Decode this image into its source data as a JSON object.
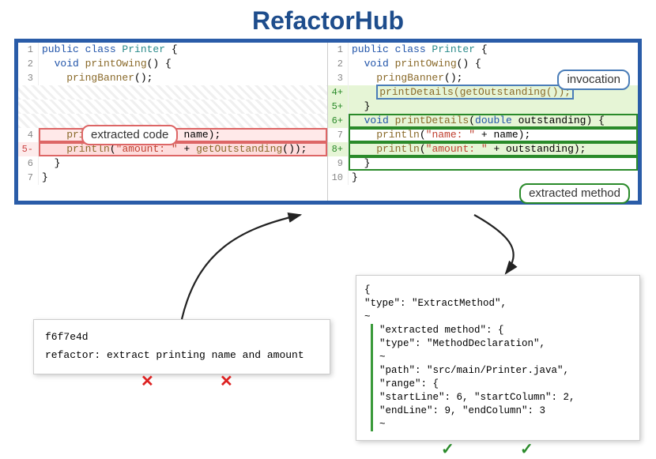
{
  "title": "RefactorHub",
  "tags": {
    "extracted_code": "extracted code",
    "invocation": "invocation",
    "extracted_method": "extracted method"
  },
  "left": {
    "lines": [
      {
        "n": "1",
        "seg": [
          {
            "t": "public ",
            "c": "tk-k"
          },
          {
            "t": "class ",
            "c": "tk-k"
          },
          {
            "t": "Printer",
            "c": "tk-t"
          },
          {
            "t": " {",
            "c": ""
          }
        ]
      },
      {
        "n": "2",
        "seg": [
          {
            "t": "  void ",
            "c": "tk-k"
          },
          {
            "t": "printOwing",
            "c": "tk-m"
          },
          {
            "t": "() {",
            "c": ""
          }
        ]
      },
      {
        "n": "3",
        "seg": [
          {
            "t": "    pringBanner",
            "c": "tk-m"
          },
          {
            "t": "();",
            "c": ""
          }
        ]
      },
      {
        "n": "",
        "seg": [],
        "hatch": true
      },
      {
        "n": "",
        "seg": [],
        "hatch": true
      },
      {
        "n": "",
        "seg": [],
        "hatch": true
      },
      {
        "n": "4",
        "seg": [
          {
            "t": "    println",
            "c": "tk-m"
          },
          {
            "t": "(",
            "c": ""
          },
          {
            "t": "\"name: \"",
            "c": "tk-s"
          },
          {
            "t": " + name);",
            "c": ""
          }
        ],
        "pink": true
      },
      {
        "n": "5-",
        "seg": [
          {
            "t": "    println",
            "c": "tk-m"
          },
          {
            "t": "(",
            "c": ""
          },
          {
            "t": "\"amount: \"",
            "c": "tk-s"
          },
          {
            "t": " + ",
            "c": ""
          },
          {
            "t": "getOutstanding",
            "c": "tk-m"
          },
          {
            "t": "());",
            "c": ""
          }
        ],
        "pink": true,
        "del": true
      },
      {
        "n": "6",
        "seg": [
          {
            "t": "  }",
            "c": ""
          }
        ]
      },
      {
        "n": "7",
        "seg": [
          {
            "t": "}",
            "c": ""
          }
        ]
      }
    ]
  },
  "right": {
    "lines": [
      {
        "n": "1",
        "seg": [
          {
            "t": "public ",
            "c": "tk-k"
          },
          {
            "t": "class ",
            "c": "tk-k"
          },
          {
            "t": "Printer",
            "c": "tk-t"
          },
          {
            "t": " {",
            "c": ""
          }
        ]
      },
      {
        "n": "2",
        "seg": [
          {
            "t": "  void ",
            "c": "tk-k"
          },
          {
            "t": "printOwing",
            "c": "tk-m"
          },
          {
            "t": "() {",
            "c": ""
          }
        ]
      },
      {
        "n": "3",
        "seg": [
          {
            "t": "    pringBanner",
            "c": "tk-m"
          },
          {
            "t": "();",
            "c": ""
          }
        ]
      },
      {
        "n": "4+",
        "seg": [
          {
            "t": "    ",
            "c": ""
          },
          {
            "t": "printDetails(getOutstanding());",
            "c": "tk-m",
            "inv": true
          }
        ],
        "add": true
      },
      {
        "n": "5+",
        "seg": [
          {
            "t": "  }",
            "c": ""
          }
        ],
        "add": true
      },
      {
        "n": "6+",
        "seg": [
          {
            "t": "  void ",
            "c": "tk-k"
          },
          {
            "t": "printDetails",
            "c": "tk-m"
          },
          {
            "t": "(",
            "c": ""
          },
          {
            "t": "double",
            "c": "tk-k"
          },
          {
            "t": " outstanding) {",
            "c": ""
          }
        ],
        "add": true,
        "green": true
      },
      {
        "n": "7",
        "seg": [
          {
            "t": "    println",
            "c": "tk-m"
          },
          {
            "t": "(",
            "c": ""
          },
          {
            "t": "\"name: \"",
            "c": "tk-s"
          },
          {
            "t": " + name);",
            "c": ""
          }
        ],
        "green": true
      },
      {
        "n": "8+",
        "seg": [
          {
            "t": "    println",
            "c": "tk-m"
          },
          {
            "t": "(",
            "c": ""
          },
          {
            "t": "\"amount: \"",
            "c": "tk-s"
          },
          {
            "t": " + outstanding);",
            "c": ""
          }
        ],
        "add": true,
        "green": true
      },
      {
        "n": "9",
        "seg": [
          {
            "t": "  }",
            "c": ""
          }
        ],
        "green": true
      },
      {
        "n": "10",
        "seg": [
          {
            "t": "}",
            "c": ""
          }
        ]
      }
    ]
  },
  "commit": {
    "hash": "f6f7e4d",
    "msg": "refactor: extract printing name and amount"
  },
  "json_lines": [
    "{",
    "  \"type\": \"ExtractMethod\",",
    "  ~",
    "G   \"extracted method\": {",
    "G     \"type\": \"MethodDeclaration\",",
    "G     ~",
    "G     \"path\": \"src/main/Printer.java\",",
    "G     \"range\": {",
    "G       \"startLine\": 6, \"startColumn\": 2,",
    "G       \"endLine\": 9, \"endColumn\": 3",
    "G     ~"
  ],
  "marks": {
    "x1": "✕",
    "x2": "✕",
    "v1": "✓",
    "v2": "✓"
  }
}
